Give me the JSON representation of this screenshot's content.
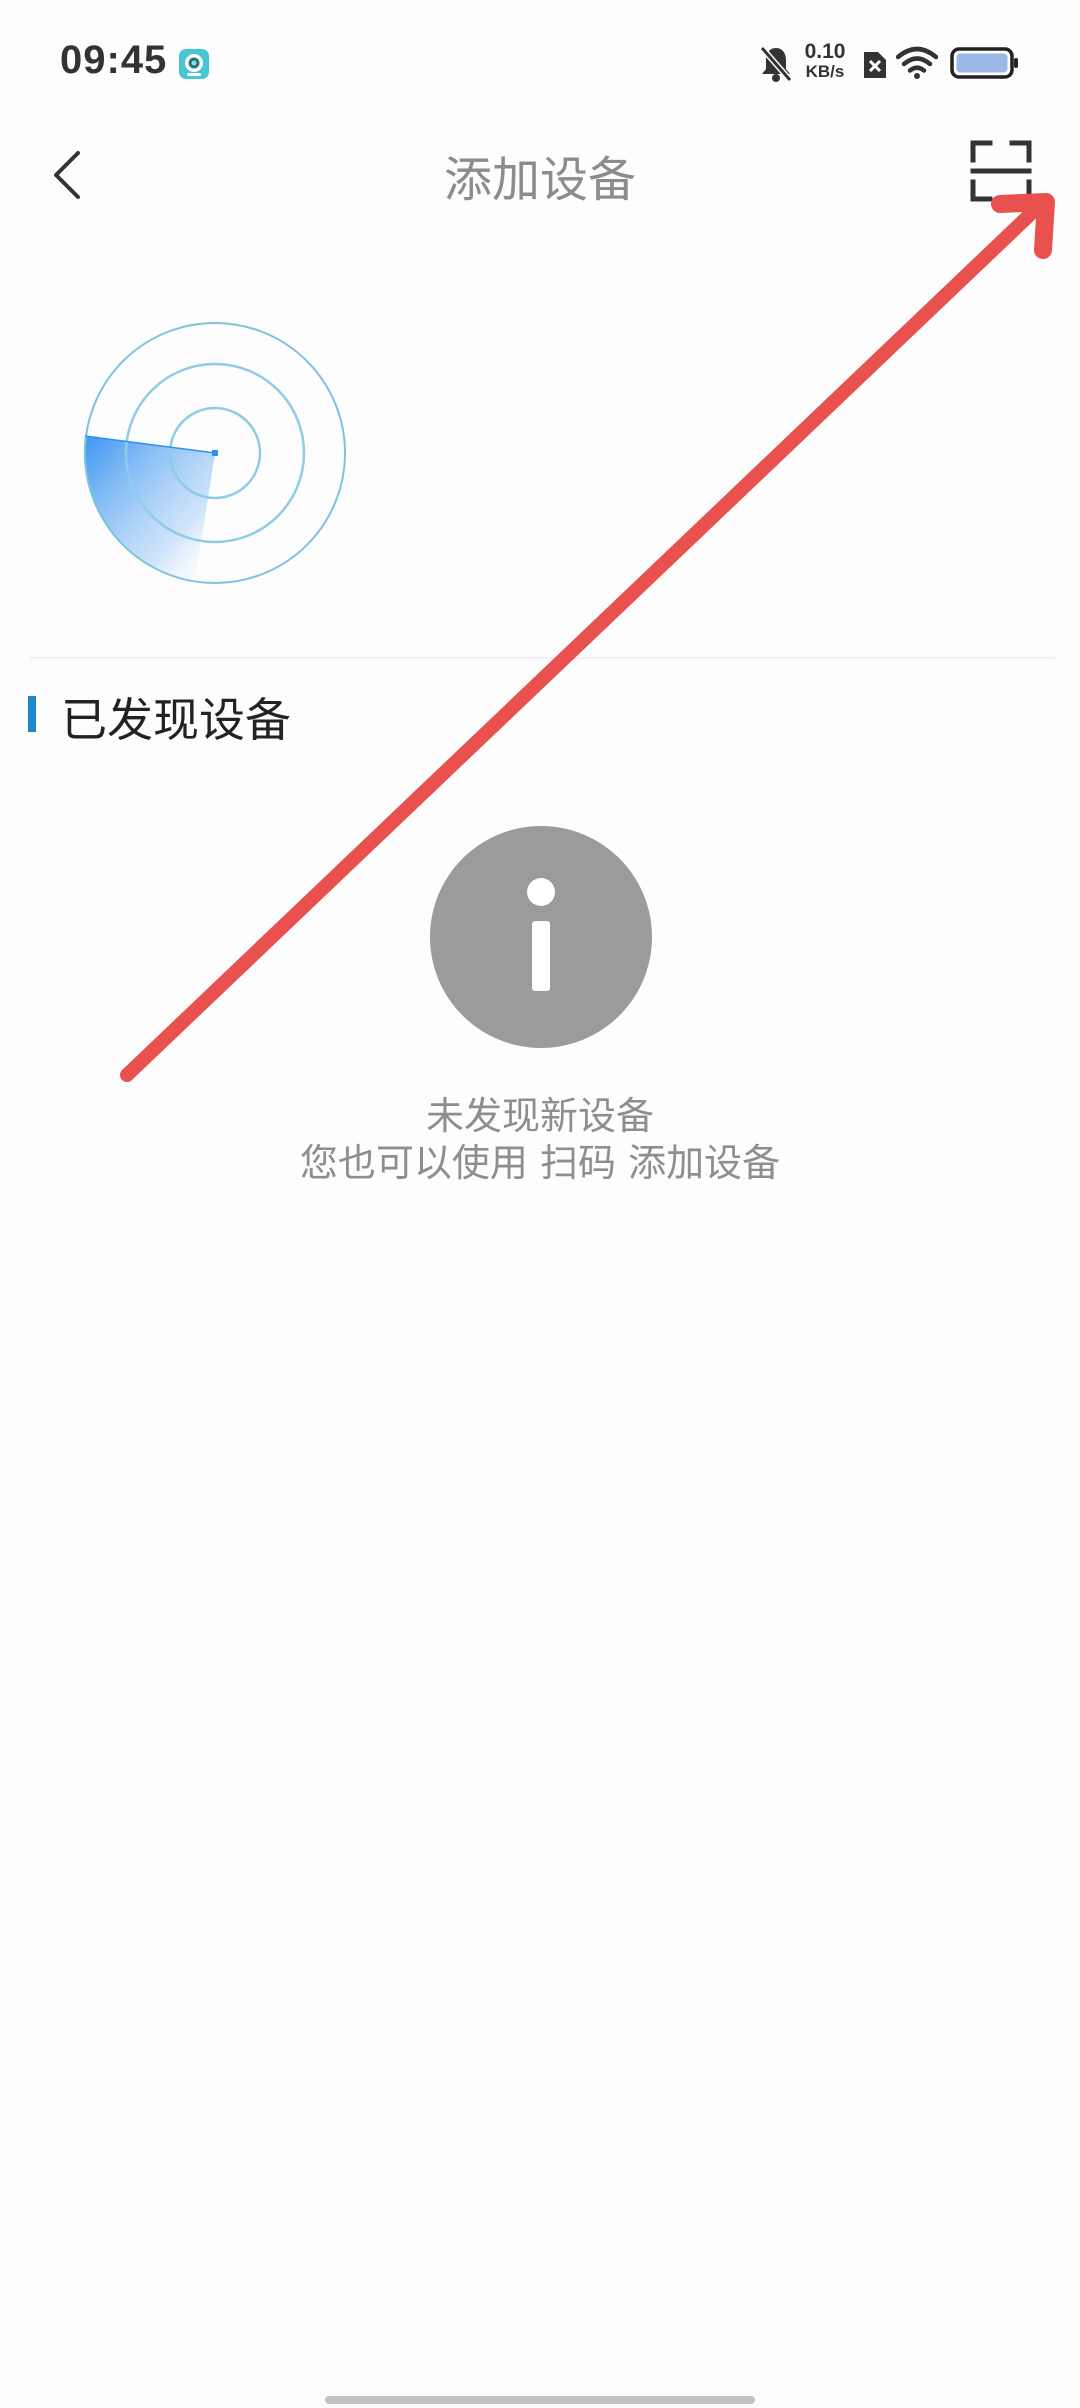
{
  "status_bar": {
    "time": "09:45",
    "net_speed_value": "0.10",
    "net_speed_unit": "KB/s",
    "icons": [
      "app-notification-icon",
      "mute-bell-icon",
      "sim-x-icon",
      "wifi-icon",
      "battery-icon"
    ]
  },
  "header": {
    "title": "添加设备",
    "back_icon": "chevron-left-icon",
    "scan_icon": "scan-frame-icon"
  },
  "radar": {
    "icon": "radar-scan-icon"
  },
  "section": {
    "title": "已发现设备"
  },
  "empty_state": {
    "icon": "info-icon",
    "line1": "未发现新设备",
    "line2": "您也可以使用 扫码 添加设备"
  },
  "annotation": {
    "icon": "red-arrow-annotation",
    "color": "#e8514e"
  },
  "colors": {
    "accent": "#1a8ac9",
    "radar_blue": "#2f8ff0",
    "gray_icon": "#9b9b9b",
    "title_gray": "#8c8c8c"
  }
}
